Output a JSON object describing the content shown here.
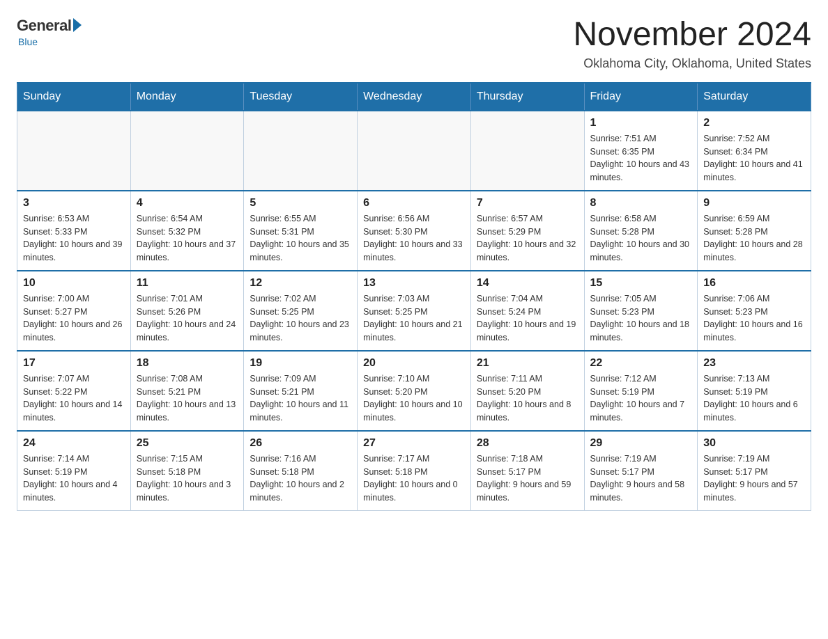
{
  "logo": {
    "general": "General",
    "blue": "Blue",
    "subtitle": "Blue"
  },
  "title": "November 2024",
  "location": "Oklahoma City, Oklahoma, United States",
  "days_of_week": [
    "Sunday",
    "Monday",
    "Tuesday",
    "Wednesday",
    "Thursday",
    "Friday",
    "Saturday"
  ],
  "weeks": [
    [
      {
        "day": "",
        "info": ""
      },
      {
        "day": "",
        "info": ""
      },
      {
        "day": "",
        "info": ""
      },
      {
        "day": "",
        "info": ""
      },
      {
        "day": "",
        "info": ""
      },
      {
        "day": "1",
        "info": "Sunrise: 7:51 AM\nSunset: 6:35 PM\nDaylight: 10 hours and 43 minutes."
      },
      {
        "day": "2",
        "info": "Sunrise: 7:52 AM\nSunset: 6:34 PM\nDaylight: 10 hours and 41 minutes."
      }
    ],
    [
      {
        "day": "3",
        "info": "Sunrise: 6:53 AM\nSunset: 5:33 PM\nDaylight: 10 hours and 39 minutes."
      },
      {
        "day": "4",
        "info": "Sunrise: 6:54 AM\nSunset: 5:32 PM\nDaylight: 10 hours and 37 minutes."
      },
      {
        "day": "5",
        "info": "Sunrise: 6:55 AM\nSunset: 5:31 PM\nDaylight: 10 hours and 35 minutes."
      },
      {
        "day": "6",
        "info": "Sunrise: 6:56 AM\nSunset: 5:30 PM\nDaylight: 10 hours and 33 minutes."
      },
      {
        "day": "7",
        "info": "Sunrise: 6:57 AM\nSunset: 5:29 PM\nDaylight: 10 hours and 32 minutes."
      },
      {
        "day": "8",
        "info": "Sunrise: 6:58 AM\nSunset: 5:28 PM\nDaylight: 10 hours and 30 minutes."
      },
      {
        "day": "9",
        "info": "Sunrise: 6:59 AM\nSunset: 5:28 PM\nDaylight: 10 hours and 28 minutes."
      }
    ],
    [
      {
        "day": "10",
        "info": "Sunrise: 7:00 AM\nSunset: 5:27 PM\nDaylight: 10 hours and 26 minutes."
      },
      {
        "day": "11",
        "info": "Sunrise: 7:01 AM\nSunset: 5:26 PM\nDaylight: 10 hours and 24 minutes."
      },
      {
        "day": "12",
        "info": "Sunrise: 7:02 AM\nSunset: 5:25 PM\nDaylight: 10 hours and 23 minutes."
      },
      {
        "day": "13",
        "info": "Sunrise: 7:03 AM\nSunset: 5:25 PM\nDaylight: 10 hours and 21 minutes."
      },
      {
        "day": "14",
        "info": "Sunrise: 7:04 AM\nSunset: 5:24 PM\nDaylight: 10 hours and 19 minutes."
      },
      {
        "day": "15",
        "info": "Sunrise: 7:05 AM\nSunset: 5:23 PM\nDaylight: 10 hours and 18 minutes."
      },
      {
        "day": "16",
        "info": "Sunrise: 7:06 AM\nSunset: 5:23 PM\nDaylight: 10 hours and 16 minutes."
      }
    ],
    [
      {
        "day": "17",
        "info": "Sunrise: 7:07 AM\nSunset: 5:22 PM\nDaylight: 10 hours and 14 minutes."
      },
      {
        "day": "18",
        "info": "Sunrise: 7:08 AM\nSunset: 5:21 PM\nDaylight: 10 hours and 13 minutes."
      },
      {
        "day": "19",
        "info": "Sunrise: 7:09 AM\nSunset: 5:21 PM\nDaylight: 10 hours and 11 minutes."
      },
      {
        "day": "20",
        "info": "Sunrise: 7:10 AM\nSunset: 5:20 PM\nDaylight: 10 hours and 10 minutes."
      },
      {
        "day": "21",
        "info": "Sunrise: 7:11 AM\nSunset: 5:20 PM\nDaylight: 10 hours and 8 minutes."
      },
      {
        "day": "22",
        "info": "Sunrise: 7:12 AM\nSunset: 5:19 PM\nDaylight: 10 hours and 7 minutes."
      },
      {
        "day": "23",
        "info": "Sunrise: 7:13 AM\nSunset: 5:19 PM\nDaylight: 10 hours and 6 minutes."
      }
    ],
    [
      {
        "day": "24",
        "info": "Sunrise: 7:14 AM\nSunset: 5:19 PM\nDaylight: 10 hours and 4 minutes."
      },
      {
        "day": "25",
        "info": "Sunrise: 7:15 AM\nSunset: 5:18 PM\nDaylight: 10 hours and 3 minutes."
      },
      {
        "day": "26",
        "info": "Sunrise: 7:16 AM\nSunset: 5:18 PM\nDaylight: 10 hours and 2 minutes."
      },
      {
        "day": "27",
        "info": "Sunrise: 7:17 AM\nSunset: 5:18 PM\nDaylight: 10 hours and 0 minutes."
      },
      {
        "day": "28",
        "info": "Sunrise: 7:18 AM\nSunset: 5:17 PM\nDaylight: 9 hours and 59 minutes."
      },
      {
        "day": "29",
        "info": "Sunrise: 7:19 AM\nSunset: 5:17 PM\nDaylight: 9 hours and 58 minutes."
      },
      {
        "day": "30",
        "info": "Sunrise: 7:19 AM\nSunset: 5:17 PM\nDaylight: 9 hours and 57 minutes."
      }
    ]
  ]
}
